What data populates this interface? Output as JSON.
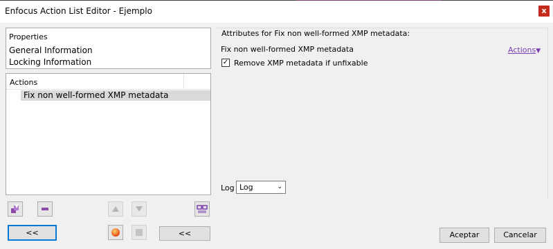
{
  "window": {
    "title": "Enfocus Action List Editor - Ejemplo",
    "close_label": "x"
  },
  "properties": {
    "header": "Properties",
    "items": [
      "General Information",
      "Locking Information"
    ]
  },
  "actions_panel": {
    "header": "Actions",
    "items": [
      "Fix non well-formed XMP metadata"
    ]
  },
  "attributes": {
    "legend": "Attributes for Fix non well-formed XMP metadata:",
    "action_name": "Fix non well-formed XMP metadata",
    "actions_link": "Actions",
    "checkbox_label": "Remove XMP metadata if unfixable",
    "checkbox_checked": true,
    "log_label": "Log",
    "log_value": "Log"
  },
  "toolbar": {
    "left_collapse_label": "<<",
    "middle_collapse_label": "<<"
  },
  "footer": {
    "ok_label": "Aceptar",
    "cancel_label": "Cancelar"
  },
  "icons": [
    "add-action-icon",
    "remove-action-icon",
    "move-up-icon",
    "move-down-icon",
    "glasses-icon",
    "record-icon",
    "stop-icon"
  ],
  "colors": {
    "accent": "#7a3fb0",
    "close": "#c42b1c",
    "focus": "#0078d7"
  }
}
